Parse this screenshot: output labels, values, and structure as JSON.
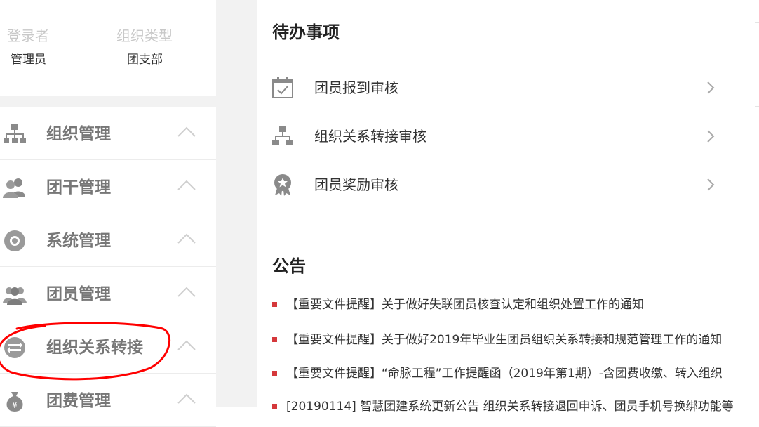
{
  "user_info": {
    "login_label": "登录者",
    "login_value": "管理员",
    "org_type_label": "组织类型",
    "org_type_value": "团支部"
  },
  "sidebar": {
    "items": [
      {
        "label": "组织管理",
        "icon": "org-chart-icon"
      },
      {
        "label": "团干管理",
        "icon": "users-icon"
      },
      {
        "label": "系统管理",
        "icon": "gear-icon"
      },
      {
        "label": "团员管理",
        "icon": "group-icon"
      },
      {
        "label": "组织关系转接",
        "icon": "transfer-icon"
      },
      {
        "label": "团费管理",
        "icon": "money-bag-icon"
      }
    ]
  },
  "todo": {
    "title": "待办事项",
    "items": [
      {
        "label": "团员报到审核",
        "icon": "calendar-check-icon"
      },
      {
        "label": "组织关系转接审核",
        "icon": "org-chart-icon"
      },
      {
        "label": "团员奖励审核",
        "icon": "award-icon"
      }
    ]
  },
  "notices": {
    "title": "公告",
    "items": [
      "【重要文件提醒】关于做好失联团员核查认定和组织处置工作的通知",
      "【重要文件提醒】关于做好2019年毕业生团员组织关系转接和规范管理工作的通知",
      "【重要文件提醒】“命脉工程”工作提醒函（2019年第1期）-含团费收缴、转入组织",
      "[20190114] 智慧团建系统更新公告 组织关系转接退回申诉、团员手机号换绑功能等"
    ]
  },
  "colors": {
    "accent_red": "#d5383b",
    "annotation_red": "#ff0000",
    "icon_gray": "#8a8a8a",
    "sidebar_gray": "#f2f2f2"
  }
}
